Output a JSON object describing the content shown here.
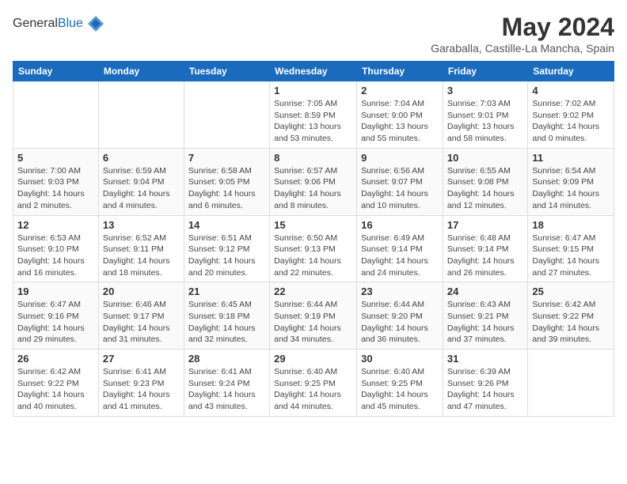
{
  "app": {
    "name_general": "General",
    "name_blue": "Blue"
  },
  "header": {
    "month": "May 2024",
    "location": "Garaballa, Castille-La Mancha, Spain"
  },
  "weekdays": [
    "Sunday",
    "Monday",
    "Tuesday",
    "Wednesday",
    "Thursday",
    "Friday",
    "Saturday"
  ],
  "weeks": [
    [
      {
        "day": "",
        "sunrise": "",
        "sunset": "",
        "daylight": ""
      },
      {
        "day": "",
        "sunrise": "",
        "sunset": "",
        "daylight": ""
      },
      {
        "day": "",
        "sunrise": "",
        "sunset": "",
        "daylight": ""
      },
      {
        "day": "1",
        "sunrise": "Sunrise: 7:05 AM",
        "sunset": "Sunset: 8:59 PM",
        "daylight": "Daylight: 13 hours and 53 minutes."
      },
      {
        "day": "2",
        "sunrise": "Sunrise: 7:04 AM",
        "sunset": "Sunset: 9:00 PM",
        "daylight": "Daylight: 13 hours and 55 minutes."
      },
      {
        "day": "3",
        "sunrise": "Sunrise: 7:03 AM",
        "sunset": "Sunset: 9:01 PM",
        "daylight": "Daylight: 13 hours and 58 minutes."
      },
      {
        "day": "4",
        "sunrise": "Sunrise: 7:02 AM",
        "sunset": "Sunset: 9:02 PM",
        "daylight": "Daylight: 14 hours and 0 minutes."
      }
    ],
    [
      {
        "day": "5",
        "sunrise": "Sunrise: 7:00 AM",
        "sunset": "Sunset: 9:03 PM",
        "daylight": "Daylight: 14 hours and 2 minutes."
      },
      {
        "day": "6",
        "sunrise": "Sunrise: 6:59 AM",
        "sunset": "Sunset: 9:04 PM",
        "daylight": "Daylight: 14 hours and 4 minutes."
      },
      {
        "day": "7",
        "sunrise": "Sunrise: 6:58 AM",
        "sunset": "Sunset: 9:05 PM",
        "daylight": "Daylight: 14 hours and 6 minutes."
      },
      {
        "day": "8",
        "sunrise": "Sunrise: 6:57 AM",
        "sunset": "Sunset: 9:06 PM",
        "daylight": "Daylight: 14 hours and 8 minutes."
      },
      {
        "day": "9",
        "sunrise": "Sunrise: 6:56 AM",
        "sunset": "Sunset: 9:07 PM",
        "daylight": "Daylight: 14 hours and 10 minutes."
      },
      {
        "day": "10",
        "sunrise": "Sunrise: 6:55 AM",
        "sunset": "Sunset: 9:08 PM",
        "daylight": "Daylight: 14 hours and 12 minutes."
      },
      {
        "day": "11",
        "sunrise": "Sunrise: 6:54 AM",
        "sunset": "Sunset: 9:09 PM",
        "daylight": "Daylight: 14 hours and 14 minutes."
      }
    ],
    [
      {
        "day": "12",
        "sunrise": "Sunrise: 6:53 AM",
        "sunset": "Sunset: 9:10 PM",
        "daylight": "Daylight: 14 hours and 16 minutes."
      },
      {
        "day": "13",
        "sunrise": "Sunrise: 6:52 AM",
        "sunset": "Sunset: 9:11 PM",
        "daylight": "Daylight: 14 hours and 18 minutes."
      },
      {
        "day": "14",
        "sunrise": "Sunrise: 6:51 AM",
        "sunset": "Sunset: 9:12 PM",
        "daylight": "Daylight: 14 hours and 20 minutes."
      },
      {
        "day": "15",
        "sunrise": "Sunrise: 6:50 AM",
        "sunset": "Sunset: 9:13 PM",
        "daylight": "Daylight: 14 hours and 22 minutes."
      },
      {
        "day": "16",
        "sunrise": "Sunrise: 6:49 AM",
        "sunset": "Sunset: 9:14 PM",
        "daylight": "Daylight: 14 hours and 24 minutes."
      },
      {
        "day": "17",
        "sunrise": "Sunrise: 6:48 AM",
        "sunset": "Sunset: 9:14 PM",
        "daylight": "Daylight: 14 hours and 26 minutes."
      },
      {
        "day": "18",
        "sunrise": "Sunrise: 6:47 AM",
        "sunset": "Sunset: 9:15 PM",
        "daylight": "Daylight: 14 hours and 27 minutes."
      }
    ],
    [
      {
        "day": "19",
        "sunrise": "Sunrise: 6:47 AM",
        "sunset": "Sunset: 9:16 PM",
        "daylight": "Daylight: 14 hours and 29 minutes."
      },
      {
        "day": "20",
        "sunrise": "Sunrise: 6:46 AM",
        "sunset": "Sunset: 9:17 PM",
        "daylight": "Daylight: 14 hours and 31 minutes."
      },
      {
        "day": "21",
        "sunrise": "Sunrise: 6:45 AM",
        "sunset": "Sunset: 9:18 PM",
        "daylight": "Daylight: 14 hours and 32 minutes."
      },
      {
        "day": "22",
        "sunrise": "Sunrise: 6:44 AM",
        "sunset": "Sunset: 9:19 PM",
        "daylight": "Daylight: 14 hours and 34 minutes."
      },
      {
        "day": "23",
        "sunrise": "Sunrise: 6:44 AM",
        "sunset": "Sunset: 9:20 PM",
        "daylight": "Daylight: 14 hours and 36 minutes."
      },
      {
        "day": "24",
        "sunrise": "Sunrise: 6:43 AM",
        "sunset": "Sunset: 9:21 PM",
        "daylight": "Daylight: 14 hours and 37 minutes."
      },
      {
        "day": "25",
        "sunrise": "Sunrise: 6:42 AM",
        "sunset": "Sunset: 9:22 PM",
        "daylight": "Daylight: 14 hours and 39 minutes."
      }
    ],
    [
      {
        "day": "26",
        "sunrise": "Sunrise: 6:42 AM",
        "sunset": "Sunset: 9:22 PM",
        "daylight": "Daylight: 14 hours and 40 minutes."
      },
      {
        "day": "27",
        "sunrise": "Sunrise: 6:41 AM",
        "sunset": "Sunset: 9:23 PM",
        "daylight": "Daylight: 14 hours and 41 minutes."
      },
      {
        "day": "28",
        "sunrise": "Sunrise: 6:41 AM",
        "sunset": "Sunset: 9:24 PM",
        "daylight": "Daylight: 14 hours and 43 minutes."
      },
      {
        "day": "29",
        "sunrise": "Sunrise: 6:40 AM",
        "sunset": "Sunset: 9:25 PM",
        "daylight": "Daylight: 14 hours and 44 minutes."
      },
      {
        "day": "30",
        "sunrise": "Sunrise: 6:40 AM",
        "sunset": "Sunset: 9:25 PM",
        "daylight": "Daylight: 14 hours and 45 minutes."
      },
      {
        "day": "31",
        "sunrise": "Sunrise: 6:39 AM",
        "sunset": "Sunset: 9:26 PM",
        "daylight": "Daylight: 14 hours and 47 minutes."
      },
      {
        "day": "",
        "sunrise": "",
        "sunset": "",
        "daylight": ""
      }
    ]
  ]
}
